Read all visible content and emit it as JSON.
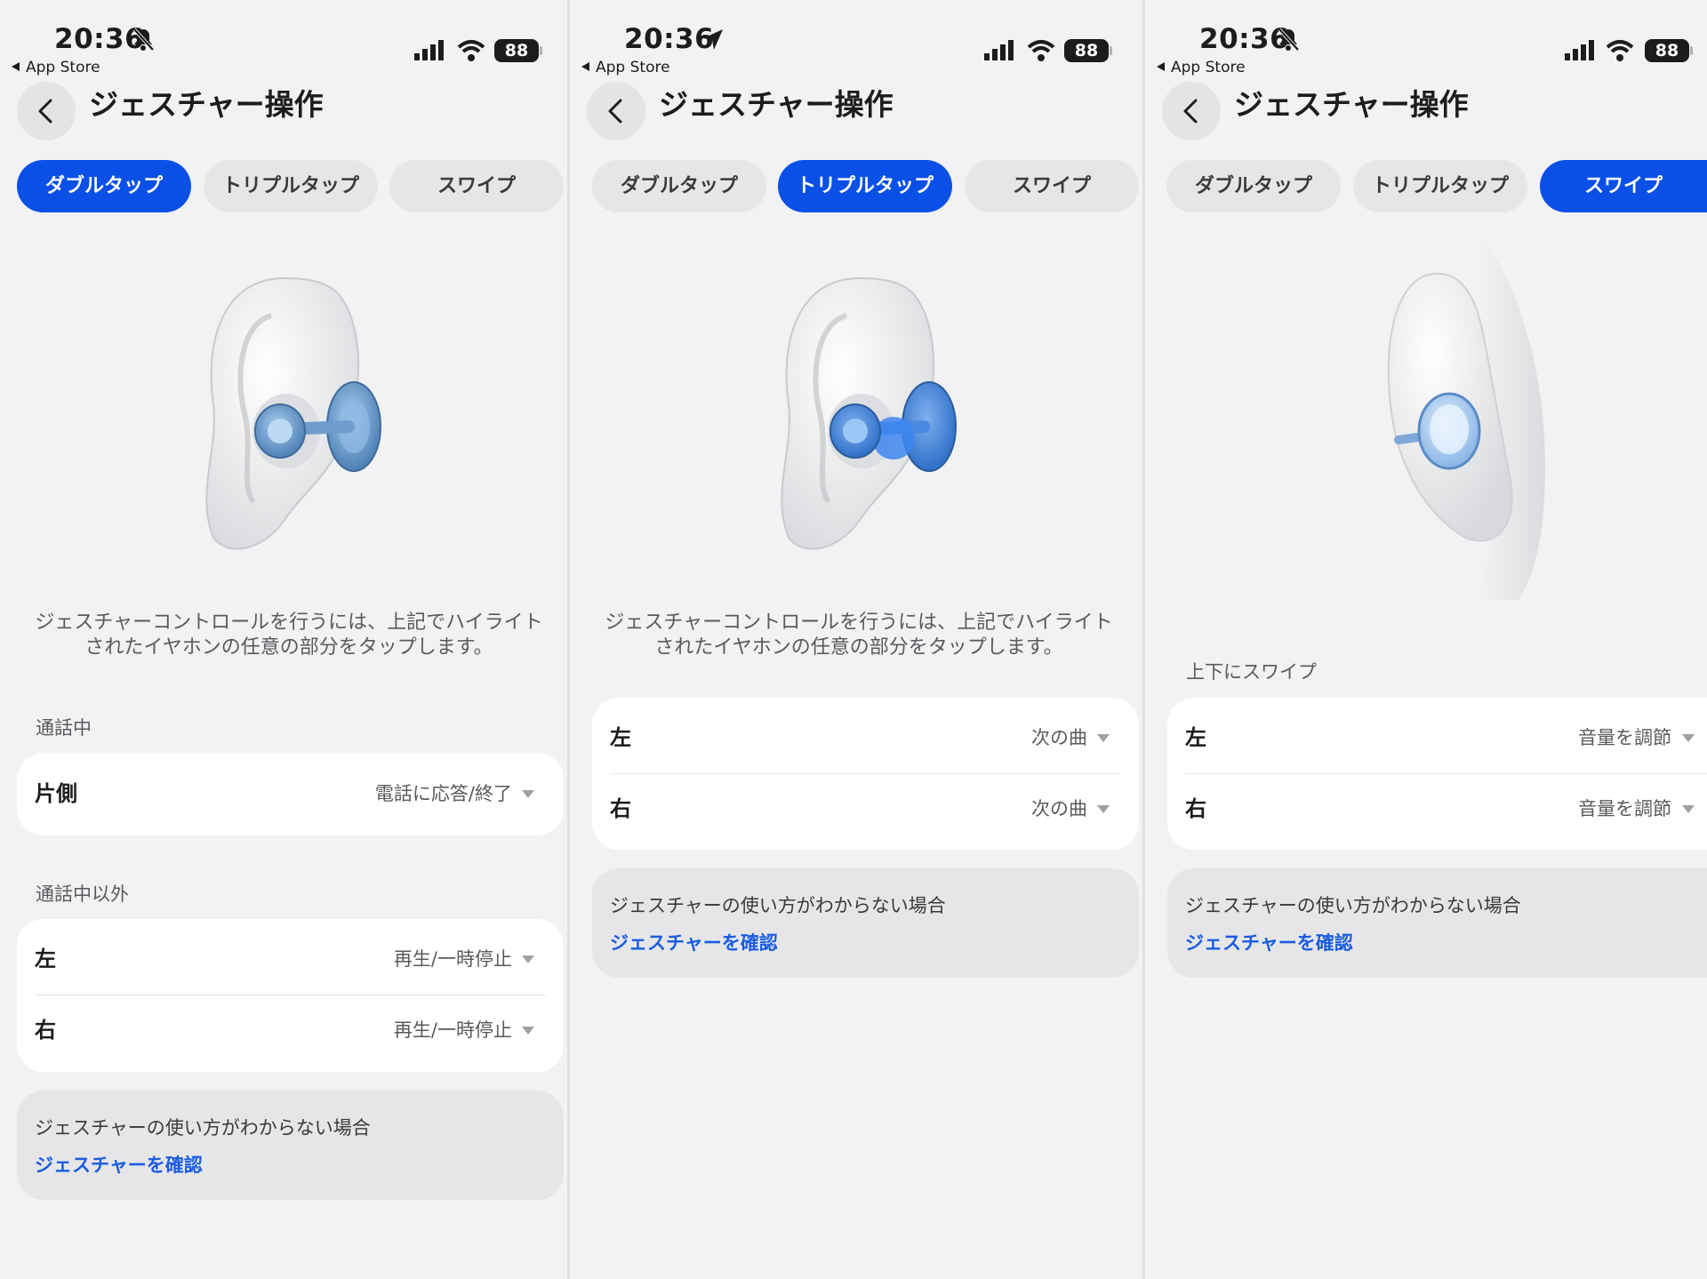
{
  "colors": {
    "accent": "#0a50e6",
    "link": "#1a5ce0",
    "background": "#f2f2f4"
  },
  "panels": [
    {
      "time": "20:36",
      "time_icon": "bell-slash-icon",
      "back_app": "App Store",
      "battery": "88",
      "title": "ジェスチャー操作",
      "tabs": [
        "ダブルタップ",
        "トリプルタップ",
        "スワイプ"
      ],
      "active_tab": 0,
      "description_line1": "ジェスチャーコントロールを行うには、上記でハイライト",
      "description_line2": "されたイヤホンの任意の部分をタップします。",
      "section1_label": "通話中",
      "section1_rows": [
        {
          "label": "片側",
          "value": "電話に応答/終了"
        }
      ],
      "section2_label": "通話中以外",
      "section2_rows": [
        {
          "label": "左",
          "value": "再生/一時停止"
        },
        {
          "label": "右",
          "value": "再生/一時停止"
        }
      ],
      "help_text": "ジェスチャーの使い方がわからない場合",
      "help_link": "ジェスチャーを確認"
    },
    {
      "time": "20:36",
      "time_icon": "location-arrow-icon",
      "back_app": "App Store",
      "battery": "88",
      "title": "ジェスチャー操作",
      "tabs": [
        "ダブルタップ",
        "トリプルタップ",
        "スワイプ"
      ],
      "active_tab": 1,
      "description_line1": "ジェスチャーコントロールを行うには、上記でハイライト",
      "description_line2": "されたイヤホンの任意の部分をタップします。",
      "rows": [
        {
          "label": "左",
          "value": "次の曲"
        },
        {
          "label": "右",
          "value": "次の曲"
        }
      ],
      "help_text": "ジェスチャーの使い方がわからない場合",
      "help_link": "ジェスチャーを確認"
    },
    {
      "time": "20:36",
      "time_icon": "bell-slash-icon",
      "back_app": "App Store",
      "battery": "88",
      "title": "ジェスチャー操作",
      "tabs": [
        "ダブルタップ",
        "トリプルタップ",
        "スワイプ"
      ],
      "active_tab": 2,
      "section_label": "上下にスワイプ",
      "rows": [
        {
          "label": "左",
          "value": "音量を調節"
        },
        {
          "label": "右",
          "value": "音量を調節"
        }
      ],
      "help_text": "ジェスチャーの使い方がわからない場合",
      "help_link": "ジェスチャーを確認"
    }
  ]
}
